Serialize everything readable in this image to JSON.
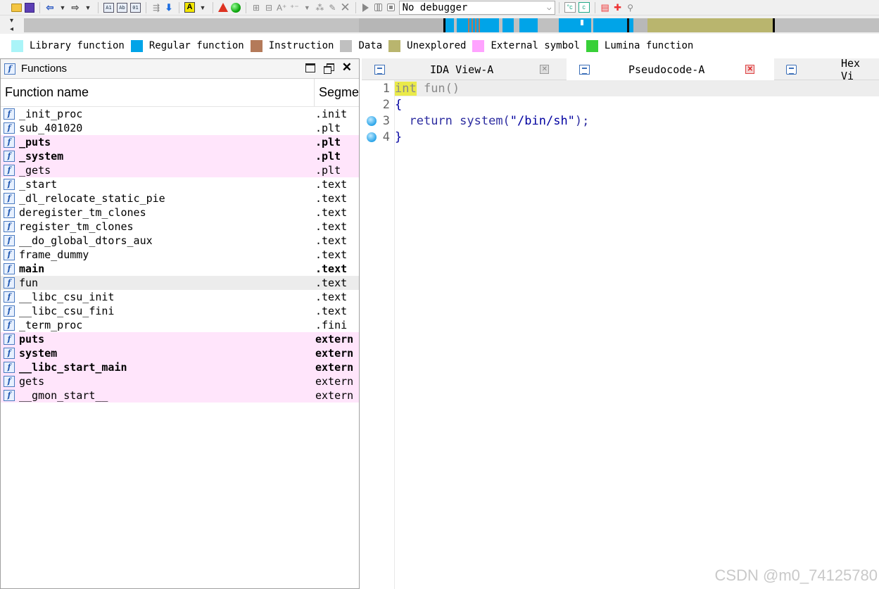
{
  "toolbar": {
    "debugger_select_value": "No debugger"
  },
  "legend": [
    {
      "label": "Library function",
      "color": "#aaf4f8"
    },
    {
      "label": "Regular function",
      "color": "#00a4e8"
    },
    {
      "label": "Instruction",
      "color": "#b47a5a"
    },
    {
      "label": "Data",
      "color": "#c0c0c0"
    },
    {
      "label": "Unexplored",
      "color": "#b9b56e"
    },
    {
      "label": "External symbol",
      "color": "#ffa3ff"
    },
    {
      "label": "Lumina function",
      "color": "#38d038"
    }
  ],
  "functions_panel": {
    "title": "Functions",
    "col_name": "Function name",
    "col_segment": "Segme",
    "rows": [
      {
        "name": "_init_proc",
        "segment": ".init",
        "style": "normal"
      },
      {
        "name": "sub_401020",
        "segment": ".plt",
        "style": "normal"
      },
      {
        "name": "_puts",
        "segment": ".plt",
        "style": "pink-bold"
      },
      {
        "name": "_system",
        "segment": ".plt",
        "style": "pink-bold"
      },
      {
        "name": "_gets",
        "segment": ".plt",
        "style": "pink"
      },
      {
        "name": "_start",
        "segment": ".text",
        "style": "normal"
      },
      {
        "name": "_dl_relocate_static_pie",
        "segment": ".text",
        "style": "normal"
      },
      {
        "name": "deregister_tm_clones",
        "segment": ".text",
        "style": "normal"
      },
      {
        "name": "register_tm_clones",
        "segment": ".text",
        "style": "normal"
      },
      {
        "name": "__do_global_dtors_aux",
        "segment": ".text",
        "style": "normal"
      },
      {
        "name": "frame_dummy",
        "segment": ".text",
        "style": "normal"
      },
      {
        "name": "main",
        "segment": ".text",
        "style": "bold"
      },
      {
        "name": "fun",
        "segment": ".text",
        "style": "selected"
      },
      {
        "name": "__libc_csu_init",
        "segment": ".text",
        "style": "normal"
      },
      {
        "name": "__libc_csu_fini",
        "segment": ".text",
        "style": "normal"
      },
      {
        "name": "_term_proc",
        "segment": ".fini",
        "style": "normal"
      },
      {
        "name": "puts",
        "segment": "extern",
        "style": "pink-bold"
      },
      {
        "name": "system",
        "segment": "extern",
        "style": "pink-bold"
      },
      {
        "name": "__libc_start_main",
        "segment": "extern",
        "style": "pink-bold"
      },
      {
        "name": "gets",
        "segment": "extern",
        "style": "pink"
      },
      {
        "name": "__gmon_start__",
        "segment": "extern",
        "style": "pink"
      }
    ]
  },
  "tabs": [
    {
      "label": "IDA View-A",
      "active": false
    },
    {
      "label": "Pseudocode-A",
      "active": true
    },
    {
      "label": "Hex Vi",
      "active": false
    }
  ],
  "pseudocode": {
    "line_numbers": [
      "1",
      "2",
      "3",
      "4"
    ],
    "breakpoint_lines": [
      3,
      4
    ],
    "line1_type": "int",
    "line1_rest": " fun()",
    "line2": "{",
    "line3_indent": "  ",
    "line3_keyword": "return",
    "line3_call": " system(",
    "line3_string": "\"/bin/sh\"",
    "line3_end": ");",
    "line4": "}"
  },
  "watermark": "CSDN @m0_74125780"
}
